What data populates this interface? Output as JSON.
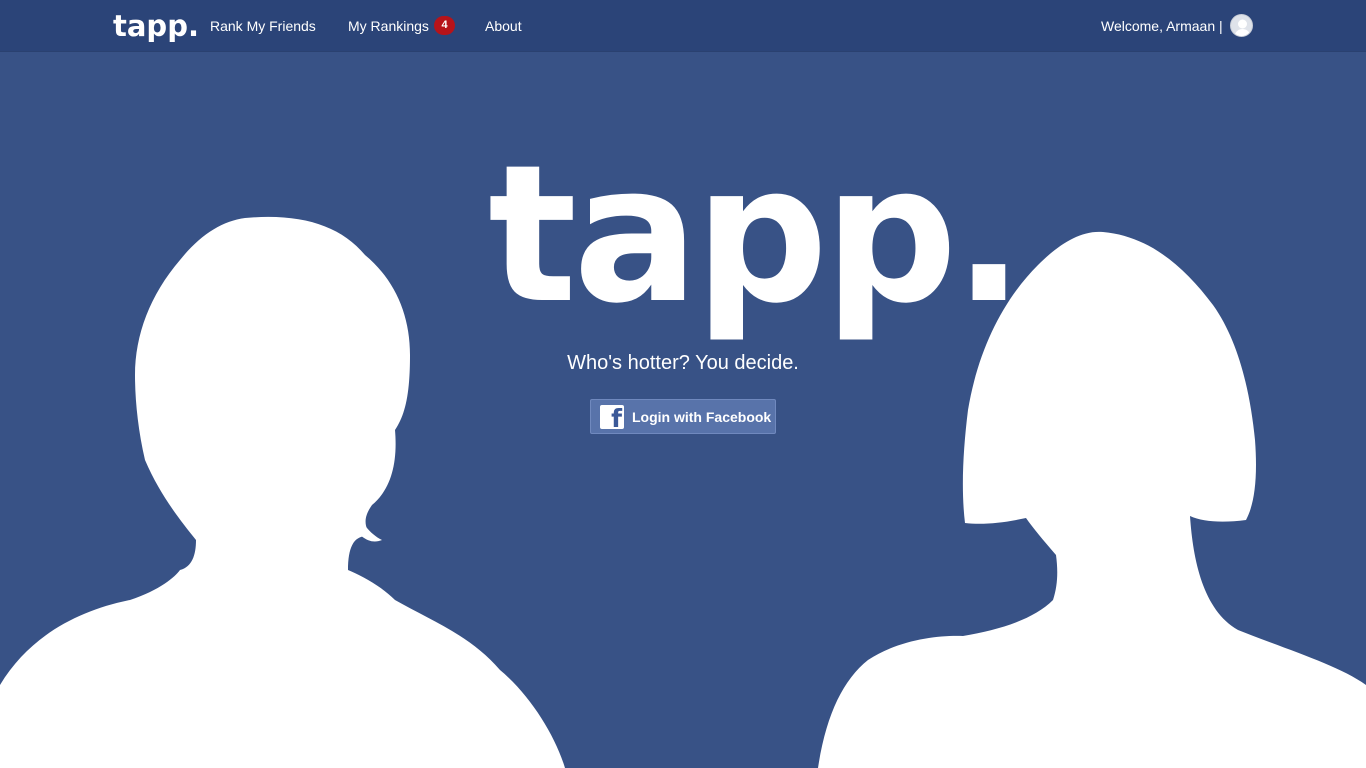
{
  "app": {
    "logo_text": "tapp."
  },
  "navbar": {
    "logo": "tapp.",
    "links": [
      {
        "label": "Rank My Friends"
      },
      {
        "label": "My Rankings"
      },
      {
        "label": "About"
      }
    ],
    "rankings_badge": "4",
    "welcome_text": "Welcome, Armaan |",
    "avatar_icon": "user-avatar-icon"
  },
  "hero": {
    "logo": "tapp.",
    "tagline": "Who's hotter? You decide.",
    "login_button": {
      "label": "Login with Facebook",
      "icon": "facebook-icon",
      "icon_letter": "f"
    }
  },
  "colors": {
    "background": "#385286",
    "navbar": "#2b4478",
    "badge": "#b71319",
    "facebook_button": "#5873aa"
  }
}
